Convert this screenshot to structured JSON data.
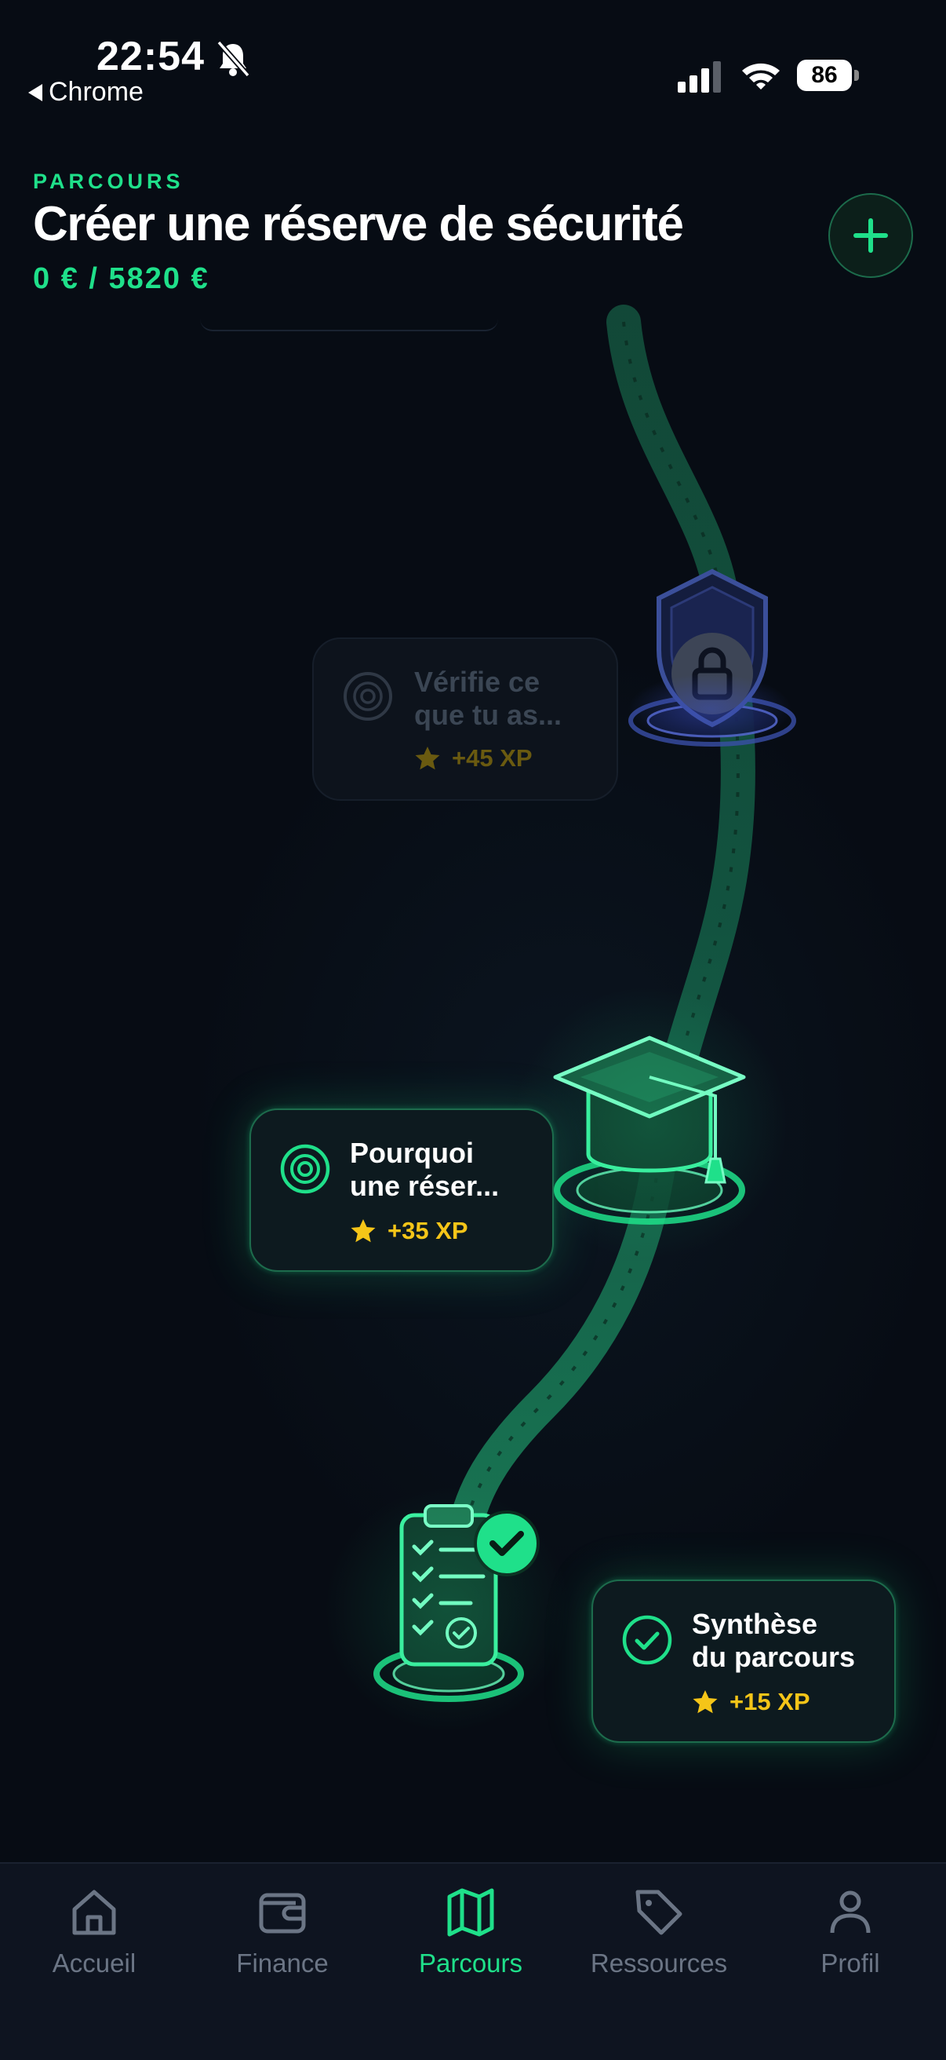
{
  "status_bar": {
    "time": "22:54",
    "back_label": "Chrome",
    "battery": "86"
  },
  "header": {
    "kicker": "PARCOURS",
    "title": "Créer une réserve de sécurité",
    "progress": "0 € / 5820 €"
  },
  "colors": {
    "accent": "#1fe08a",
    "xp": "#f5c518",
    "background": "#070c14",
    "locked": "#2f3e7a"
  },
  "steps": [
    {
      "title_line1": "Vérifie ce",
      "title_line2": "que tu as...",
      "xp": "+45 XP",
      "state": "locked",
      "node_icon": "shield-lock-icon"
    },
    {
      "title_line1": "Pourquoi",
      "title_line2": "une réser...",
      "xp": "+35 XP",
      "state": "current",
      "node_icon": "graduation-cap-icon"
    },
    {
      "title_line1": "Synthèse",
      "title_line2": "du parcours",
      "xp": "+15 XP",
      "state": "completed",
      "node_icon": "clipboard-checklist-icon"
    }
  ],
  "tabs": [
    {
      "label": "Accueil",
      "icon": "home-icon"
    },
    {
      "label": "Finance",
      "icon": "wallet-icon"
    },
    {
      "label": "Parcours",
      "icon": "map-icon",
      "active": true
    },
    {
      "label": "Ressources",
      "icon": "tag-icon"
    },
    {
      "label": "Profil",
      "icon": "user-icon"
    }
  ]
}
